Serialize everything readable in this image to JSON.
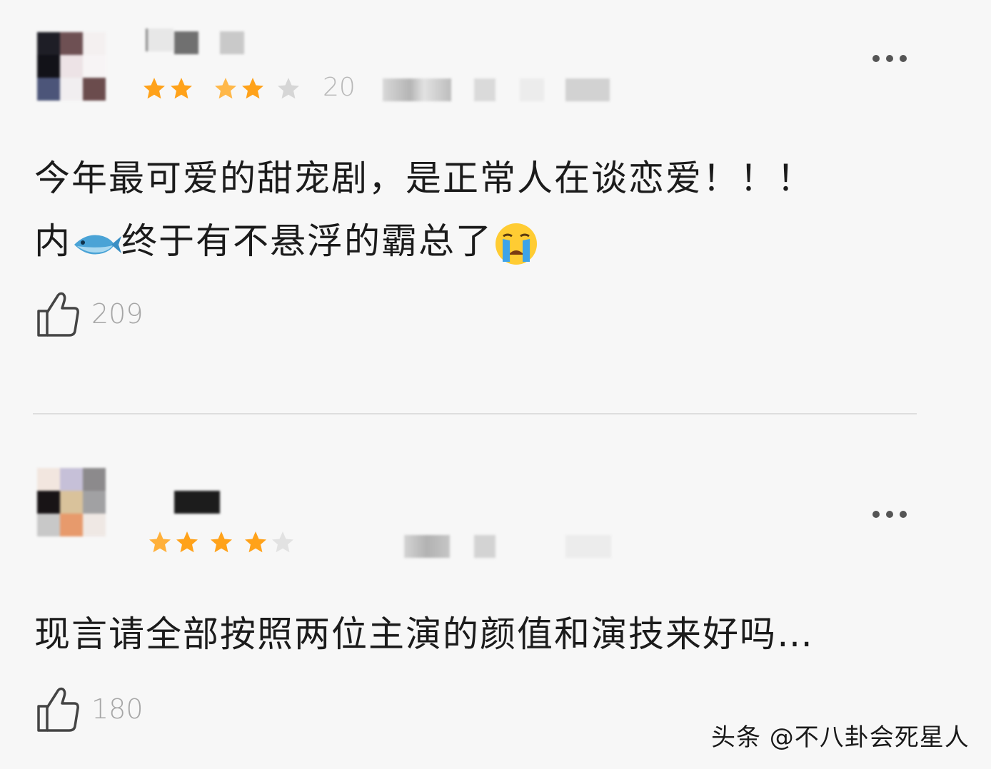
{
  "comments": [
    {
      "date_partial": "20",
      "rating_stars": 4,
      "rating_max": 5,
      "text_line1": "今年最可爱的甜宠剧，是正常人在谈恋爱！！！",
      "text_line2_a": "内",
      "text_line2_b": "终于有不悬浮的霸总了",
      "emoji_fish": "fish-icon",
      "emoji_crying": "crying-face-icon",
      "likes": "209"
    },
    {
      "rating_stars": 4,
      "rating_max": 5,
      "text_line1": "现言请全部按照两位主演的颜值和演技来好吗…",
      "likes": "180"
    }
  ],
  "watermark": "头条 @不八卦会死星人",
  "colors": {
    "star_filled": "#ffa21a",
    "star_empty": "#d6d6d6",
    "like_count": "#a6a6a6",
    "background": "#f7f7f7"
  }
}
